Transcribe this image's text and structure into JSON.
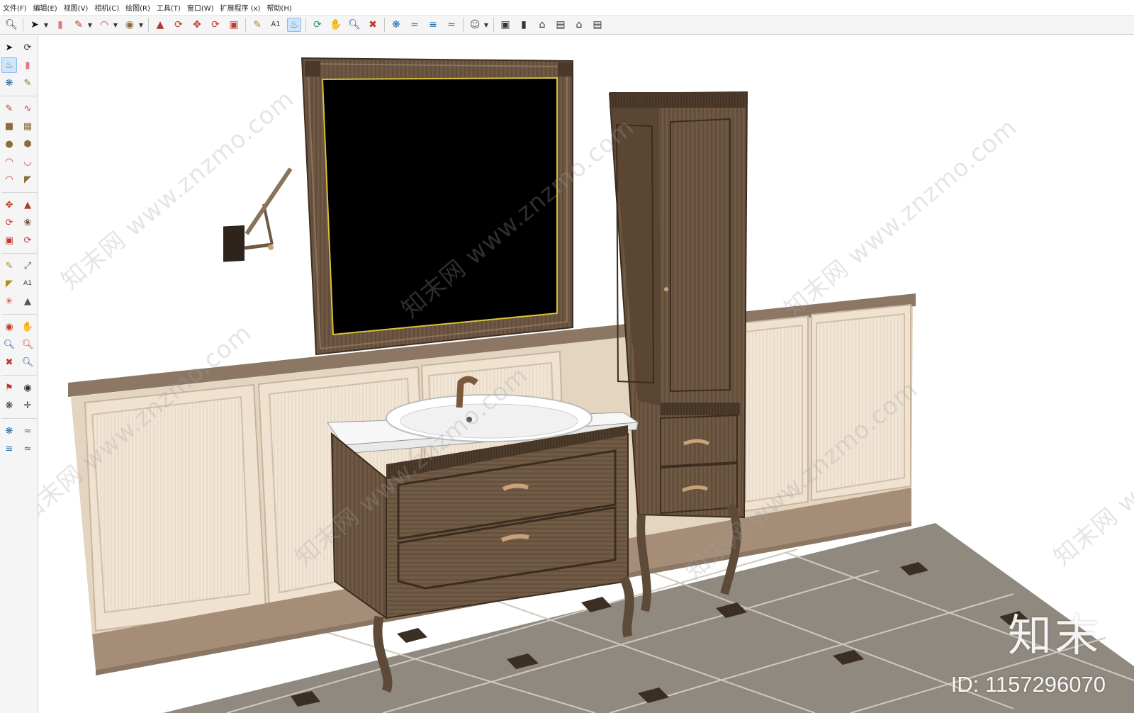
{
  "menu": {
    "items": [
      "文件(F)",
      "编辑(E)",
      "视图(V)",
      "相机(C)",
      "绘图(R)",
      "工具(T)",
      "窗口(W)",
      "扩展程序 (x)",
      "帮助(H)"
    ]
  },
  "toolbar": {
    "icons": [
      "zoom-icon",
      "select-icon",
      "eraser-icon",
      "line-icon",
      "arc-icon",
      "circle-icon",
      "push-pull-icon",
      "follow-me-icon",
      "move-icon",
      "rotate-icon",
      "scale-icon",
      "tape-measure-icon",
      "text-icon",
      "paint-bucket-icon",
      "orbit-icon",
      "pan-icon",
      "zoom-window-icon",
      "zoom-extents-icon",
      "warehouse-icon",
      "sandbox-icon",
      "layers-icon",
      "styles-icon",
      "account-icon",
      "iso-view-icon",
      "front-view-icon",
      "top-view-icon",
      "right-view-icon",
      "home-view-icon",
      "back-view-icon"
    ],
    "active": "paint-bucket-icon"
  },
  "palette": {
    "icons": [
      "select-icon",
      "orbit-icon",
      "paint-bucket-icon",
      "eraser-icon",
      "component-icon",
      "pencil-icon",
      "line-icon",
      "freehand-icon",
      "rectangle-icon",
      "rotated-rectangle-icon",
      "circle-icon",
      "polygon-icon",
      "arc-icon",
      "two-point-arc-icon",
      "three-point-arc-icon",
      "pie-icon",
      "move-icon",
      "push-pull-icon",
      "rotate-icon",
      "follow-me-icon",
      "scale-icon",
      "offset-icon",
      "tape-measure-icon",
      "dimension-icon",
      "protractor-icon",
      "text-icon",
      "axes-icon",
      "3d-text-icon",
      "section-plane-icon",
      "walk-icon",
      "zoom-icon",
      "zoom-window-icon",
      "zoom-extents-icon",
      "previous-view-icon",
      "position-camera-icon",
      "look-around-icon",
      "footprints-icon",
      "crosshair-icon",
      "sandbox-smoove-icon",
      "sandbox-stamp-icon",
      "sandbox-drape-icon",
      "sandbox-flip-icon"
    ],
    "active": "paint-bucket-icon"
  },
  "watermark": {
    "text": "知末网 www.znzmo.com",
    "brand": "知末",
    "id_label": "ID: 1157296070"
  },
  "colors": {
    "wood_dark": "#5e4a38",
    "wood_mid": "#7a6450",
    "panel_cream": "#efe3d2",
    "panel_stripe": "#e6d8c4",
    "floor_tile": "#8d877c",
    "floor_inset": "#3e3126",
    "mirror": "#000000",
    "mirror_edge": "#d8c23a",
    "basin": "#ffffff"
  }
}
